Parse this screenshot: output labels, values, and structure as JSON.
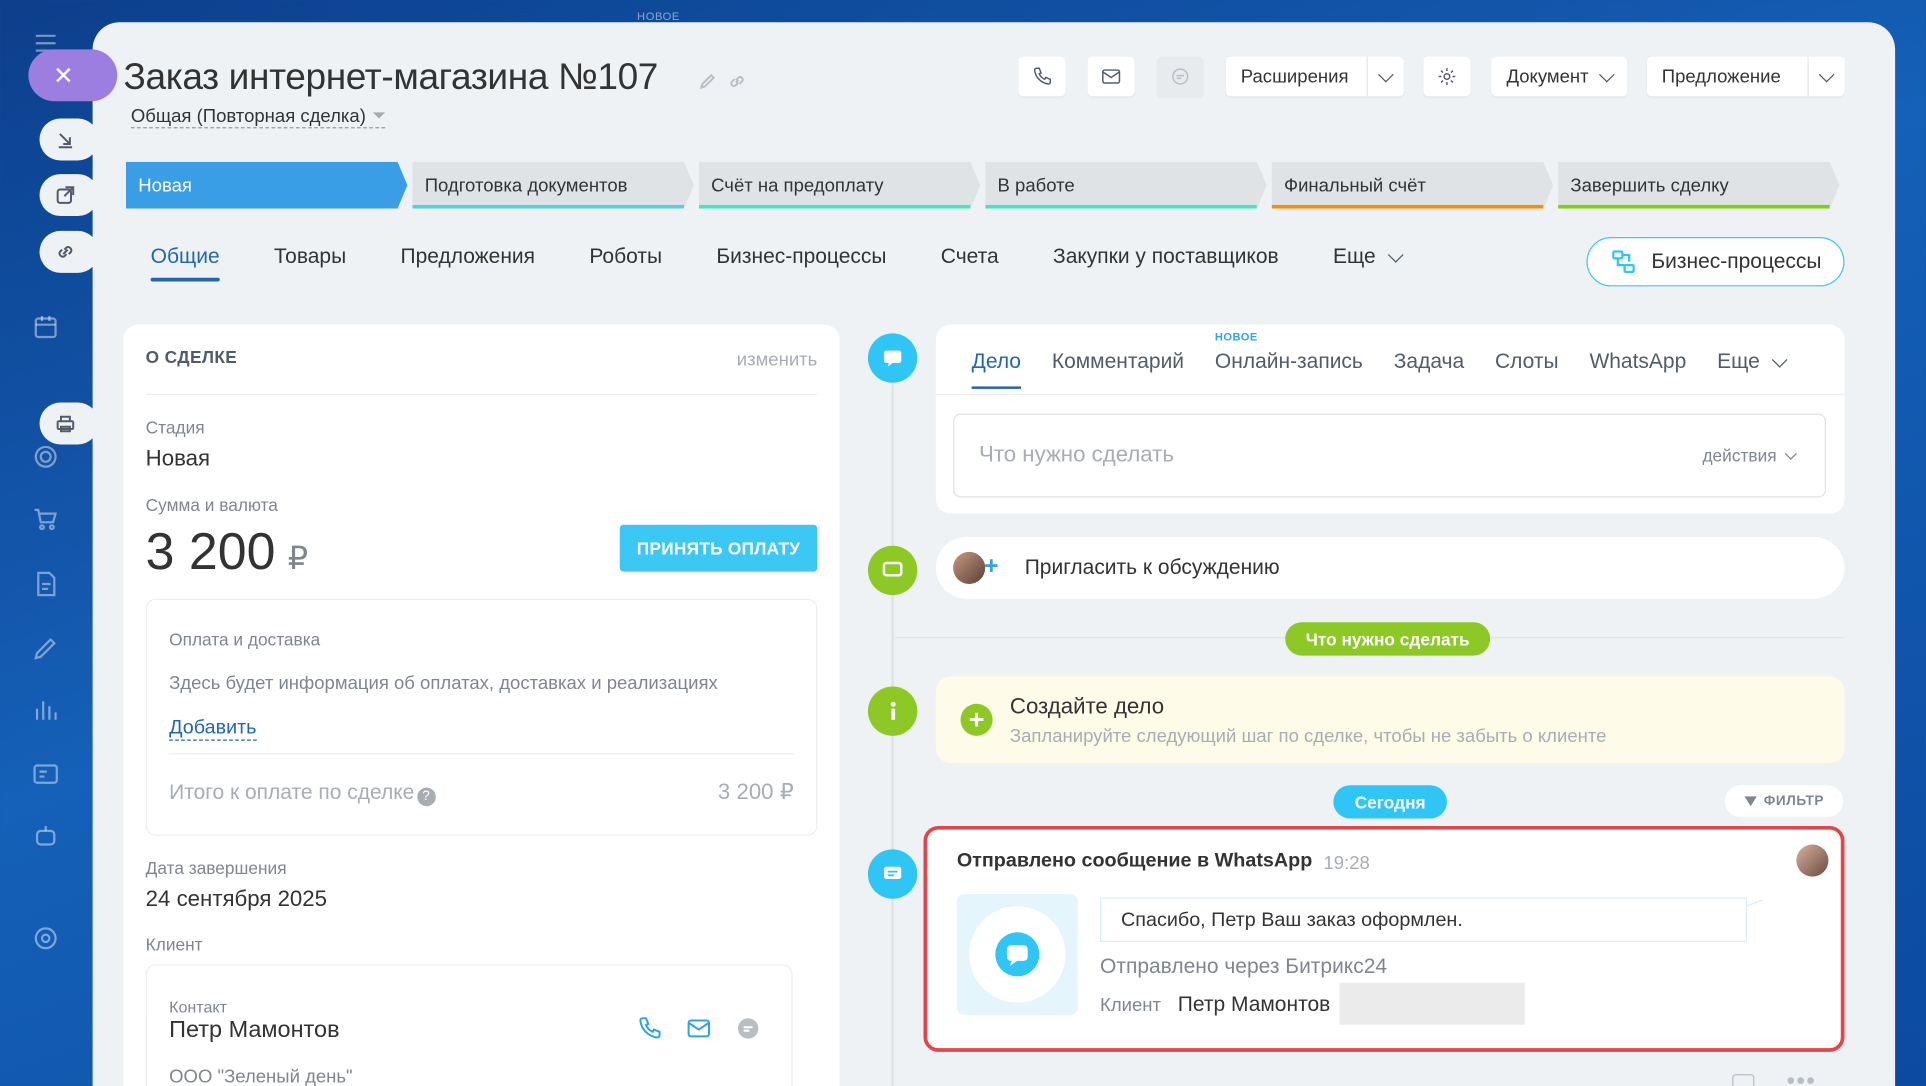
{
  "slider_badge": "НОВОЕ",
  "deal": {
    "title": "Заказ интернет-магазина №107",
    "category": "Общая (Повторная сделка)"
  },
  "toolbar": {
    "extensions": "Расширения",
    "document": "Документ",
    "proposal": "Предложение"
  },
  "stages": [
    {
      "label": "Новая",
      "color": "#3a9ee6",
      "active": true
    },
    {
      "label": "Подготовка документов",
      "color": "#55d0e0"
    },
    {
      "label": "Счёт на предоплату",
      "color": "#47e4c2"
    },
    {
      "label": "В работе",
      "color": "#ffa900"
    },
    {
      "label": "Финальный счёт",
      "color": "#ff8b00"
    },
    {
      "label": "Завершить сделку",
      "color": "#7bd500"
    }
  ],
  "tabs": [
    "Общие",
    "Товары",
    "Предложения",
    "Роботы",
    "Бизнес-процессы",
    "Счета",
    "Закупки у поставщиков",
    "Еще"
  ],
  "bp_button": "Бизнес-процессы",
  "about": {
    "header": "О СДЕЛКЕ",
    "change": "изменить",
    "stage_label": "Стадия",
    "stage_value": "Новая",
    "sum_label": "Сумма и валюта",
    "sum_value": "3 200",
    "currency": "₽",
    "pay_button": "ПРИНЯТЬ ОПЛАТУ",
    "payment_title": "Оплата и доставка",
    "payment_desc": "Здесь будет информация об оплатах, доставках и реализациях",
    "add": "Добавить",
    "total_label": "Итого к оплате по сделке",
    "total_value": "3 200 ₽",
    "close_date_label": "Дата завершения",
    "close_date_value": "24 сентября 2025",
    "client_label": "Клиент",
    "contact_label": "Контакт",
    "contact_name": "Петр Мамонтов",
    "company": "ООО \"Зеленый день\""
  },
  "editor": {
    "new_badge": "НОВОЕ",
    "tabs": [
      "Дело",
      "Комментарий",
      "Онлайн-запись",
      "Задача",
      "Слоты",
      "WhatsApp",
      "Еще"
    ],
    "placeholder": "Что нужно сделать",
    "actions": "действия"
  },
  "timeline": {
    "invite": "Пригласить к обсуждению",
    "todo_pill": "Что нужно сделать",
    "create_title": "Создайте дело",
    "create_subtitle": "Запланируйте следующий шаг по сделке, чтобы не забыть о клиенте",
    "today_pill": "Сегодня",
    "filter": "ФИЛЬТР",
    "wa_header": "Отправлено сообщение в WhatsApp",
    "wa_time": "19:28",
    "wa_message": "Спасибо, Петр Ваш заказ оформлен.",
    "wa_via": "Отправлено через Битрикс24",
    "wa_client_label": "Клиент",
    "wa_client_name": "Петр Мамонтов"
  },
  "colors": {
    "accent": "#2067b0",
    "cyan": "#3bc8f5",
    "green": "#8cc925",
    "highlight": "#e2464b"
  }
}
